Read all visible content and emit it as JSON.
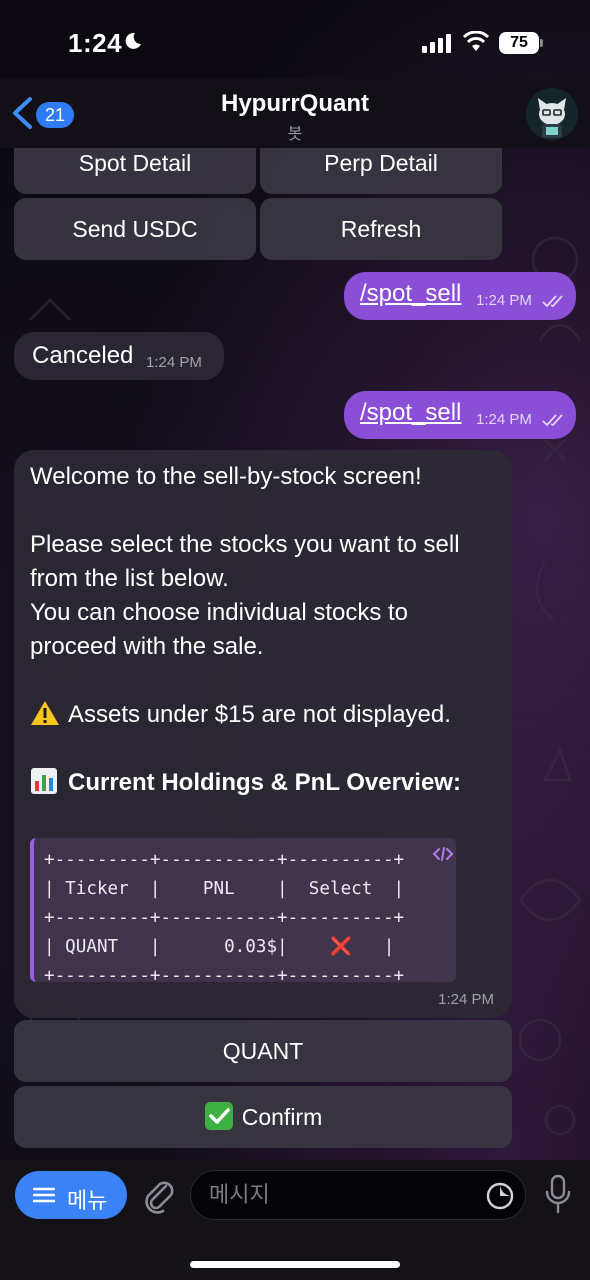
{
  "status_bar": {
    "time": "1:24",
    "battery": "75"
  },
  "header": {
    "back_count": "21",
    "title": "HypurrQuant",
    "subtitle": "봇"
  },
  "top_keyboard": [
    {
      "label": "Spot Detail"
    },
    {
      "label": "Perp Detail"
    },
    {
      "label": "Send USDC"
    },
    {
      "label": "Refresh"
    }
  ],
  "messages": {
    "out1": {
      "text": "/spot_sell",
      "time": "1:24 PM"
    },
    "in1": {
      "text": "Canceled",
      "time": "1:24 PM"
    },
    "out2": {
      "text": "/spot_sell",
      "time": "1:24 PM"
    },
    "main": {
      "line1": "Welcome to the sell-by-stock screen!",
      "line2": "Please select the stocks you want to sell",
      "line3": "from the list below.",
      "line4": "You can choose individual stocks to",
      "line5": "proceed with the sale.",
      "warning": "Assets under $15 are not displayed.",
      "overview": "Current Holdings & PnL Overview:",
      "table": {
        "border": "+---------+-----------+----------+",
        "header": "| Ticker  |    PNL    |  Select  |",
        "row_pre": "| QUANT   |      0.03$|    ",
        "row_mark": "❌",
        "row_post": "   |"
      },
      "time": "1:24 PM"
    }
  },
  "reply_keyboard": [
    {
      "label": "QUANT"
    },
    {
      "label": "Confirm",
      "icon": "check-mark-icon"
    }
  ],
  "input_bar": {
    "menu_label": "메뉴",
    "placeholder": "메시지"
  },
  "colors": {
    "accent": "#8a4fd6",
    "menu": "#3b82f6",
    "badge": "#2f7bf5"
  }
}
